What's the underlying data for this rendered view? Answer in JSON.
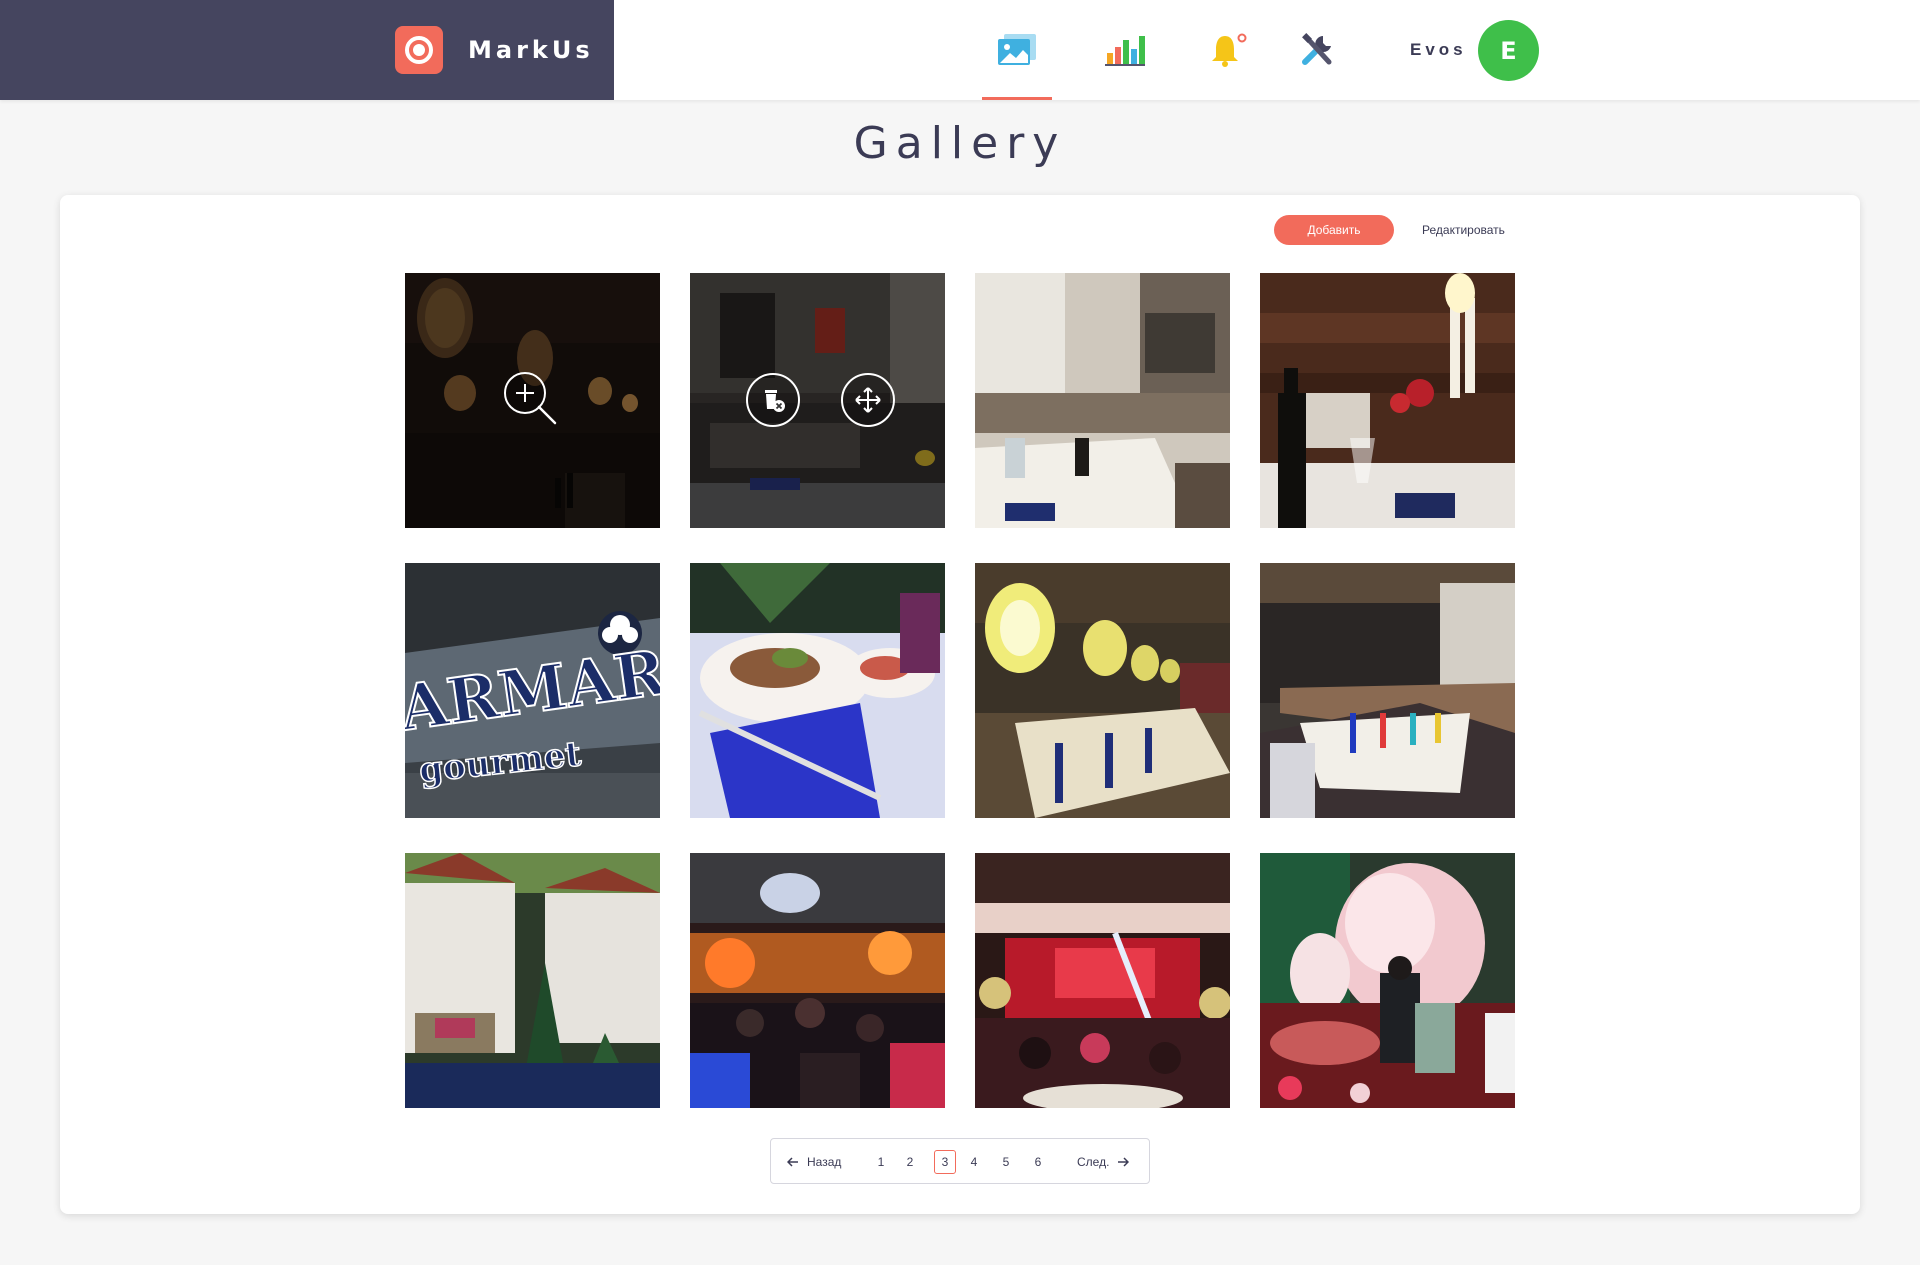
{
  "header": {
    "app_name": "MarkUs",
    "nav": [
      {
        "icon": "gallery-icon",
        "active": true
      },
      {
        "icon": "bar-chart-icon",
        "active": false
      },
      {
        "icon": "bell-icon",
        "active": false
      },
      {
        "icon": "tools-icon",
        "active": false
      }
    ],
    "user": {
      "name": "Evos",
      "avatar_letter": "E"
    }
  },
  "page": {
    "title": "Gallery"
  },
  "toolbar": {
    "add_label": "Добавить",
    "edit_label": "Редактировать"
  },
  "tiles": [
    {
      "name": "photo-dark-lanterns",
      "overlay": "zoom"
    },
    {
      "name": "photo-dining-room",
      "overlay": "delete-move"
    },
    {
      "name": "photo-white-tables"
    },
    {
      "name": "photo-candles-wine"
    },
    {
      "name": "photo-marmaris-sign",
      "text_lines": [
        "ARMARIS",
        "gourmet"
      ]
    },
    {
      "name": "photo-plates-napkins"
    },
    {
      "name": "photo-yellow-lamps"
    },
    {
      "name": "photo-long-table"
    },
    {
      "name": "photo-garden-tents"
    },
    {
      "name": "photo-party-crowd"
    },
    {
      "name": "photo-red-stage"
    },
    {
      "name": "photo-flower-decor"
    }
  ],
  "pagination": {
    "prev_label": "Назад",
    "next_label": "След.",
    "pages": [
      "1",
      "2",
      "3",
      "4",
      "5",
      "6"
    ],
    "current": "3"
  },
  "colors": {
    "accent": "#f26b5b",
    "brand_bg": "#45455f",
    "avatar": "#3fbf4a"
  }
}
